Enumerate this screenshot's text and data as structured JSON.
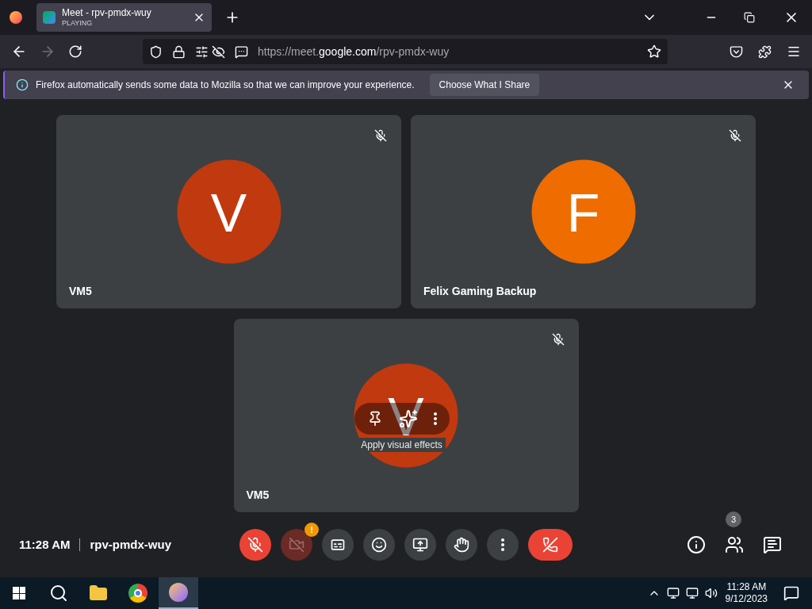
{
  "browser": {
    "tab": {
      "title": "Meet - rpv-pmdx-wuy",
      "subtitle": "PLAYING"
    },
    "url": {
      "scheme": "https://meet.",
      "domain": "google.com",
      "path": "/rpv-pmdx-wuy"
    },
    "notice": {
      "text": "Firefox automatically sends some data to Mozilla so that we can improve your experience.",
      "button": "Choose What I Share"
    }
  },
  "tiles": [
    {
      "name": "VM5",
      "initial": "V",
      "color": "#c1390f",
      "hover": false
    },
    {
      "name": "Felix Gaming Backup",
      "initial": "F",
      "color": "#ef6c00",
      "hover": false
    },
    {
      "name": "VM5",
      "initial": "V",
      "color": "#c1390f",
      "hover": true,
      "tooltip": "Apply visual effects"
    }
  ],
  "meeting": {
    "time": "11:28 AM",
    "code": "rpv-pmdx-wuy",
    "participants": "3"
  },
  "controls": [
    {
      "kind": "mic",
      "on": false
    },
    {
      "kind": "camera",
      "on": false,
      "alert": "!"
    },
    {
      "kind": "captions"
    },
    {
      "kind": "emoji"
    },
    {
      "kind": "present"
    },
    {
      "kind": "hand"
    },
    {
      "kind": "more"
    },
    {
      "kind": "leave"
    }
  ],
  "taskbar": {
    "time": "11:28 AM",
    "date": "9/12/2023"
  }
}
